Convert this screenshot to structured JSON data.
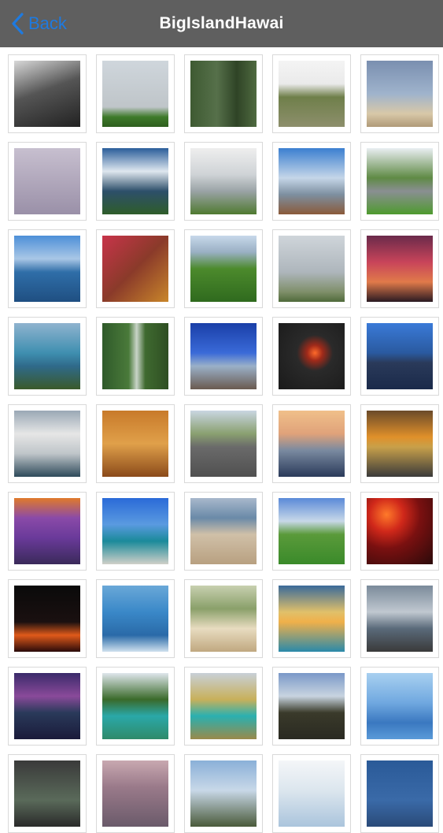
{
  "navbar": {
    "back_label": "Back",
    "title": "BigIslandHawai"
  },
  "gallery": {
    "thumbnails": [
      {
        "name": "thumb-lava-rock",
        "bg": "linear-gradient(160deg,#d8d8d8 0%,#555 45%,#222 100%)"
      },
      {
        "name": "thumb-wind-turbines",
        "bg": "linear-gradient(180deg,#cfd6dc 0%,#bfc5c9 70%,#3e7a2a 85%,#2e5e1e 100%)"
      },
      {
        "name": "thumb-green-cliffs",
        "bg": "linear-gradient(90deg,#3e5a32 0%,#56704a 40%,#2f4426 70%,#4f6a40 100%)"
      },
      {
        "name": "thumb-scrubland",
        "bg": "linear-gradient(180deg,#f4f4f4 0%,#eaeaea 35%,#6f7f4a 55%,#8d8f6c 100%)"
      },
      {
        "name": "thumb-driftwood-beach",
        "bg": "linear-gradient(180deg,#7a8fb0 0%,#9fb3cc 50%,#d8c8a8 80%,#b09a78 100%)"
      },
      {
        "name": "thumb-palm-silhouette",
        "bg": "linear-gradient(180deg,#c7bfcf 0%,#9a90a8 100%)"
      },
      {
        "name": "thumb-ocean-wave",
        "bg": "linear-gradient(180deg,#2a5d9a 0%,#dfe7ef 35%,#2d4f6a 65%,#2f5d2a 100%)"
      },
      {
        "name": "thumb-coastline-surf",
        "bg": "linear-gradient(180deg,#eeeeee 0%,#cfd3d6 40%,#9aa3a6 65%,#4f7a30 100%)"
      },
      {
        "name": "thumb-palm-mountain",
        "bg": "linear-gradient(180deg,#3b7fd0 0%,#c5d6e8 45%,#7d8fa0 70%,#8a5a3a 100%)"
      },
      {
        "name": "thumb-stone-bridge",
        "bg": "linear-gradient(180deg,#e9eef2 0%,#5f8a45 45%,#8a8f92 65%,#4e9a2e 100%)"
      },
      {
        "name": "thumb-calm-bay",
        "bg": "linear-gradient(180deg,#4d8fd8 0%,#a9c7e6 35%,#2f6ea8 55%,#1f4f82 100%)"
      },
      {
        "name": "thumb-red-coral-fish",
        "bg": "linear-gradient(135deg,#c8344a 0%,#8a3a2a 50%,#c9862a 100%)"
      },
      {
        "name": "thumb-green-fields",
        "bg": "linear-gradient(180deg,#c7d8ea 0%,#9ab0c4 25%,#4c8a2c 50%,#2f6a1e 100%)"
      },
      {
        "name": "thumb-white-church",
        "bg": "linear-gradient(180deg,#cfd5da 0%,#aeb6bc 55%,#7f8f6a 85%,#4f6a3a 100%)"
      },
      {
        "name": "thumb-red-sunset-palms",
        "bg": "linear-gradient(180deg,#6a2a4a 0%,#c8445a 40%,#e07a4a 70%,#2a1a22 100%)"
      },
      {
        "name": "thumb-coast-palm",
        "bg": "linear-gradient(180deg,#8fb3cf 0%,#3f8fb0 45%,#2f6a8a 65%,#3a5a2a 100%)"
      },
      {
        "name": "thumb-waterfall",
        "bg": "linear-gradient(90deg,#2f5a2a 0%,#4a7a3a 40%,#c8d4c8 52%,#3f6a30 65%,#2e4e22 100%)"
      },
      {
        "name": "thumb-blue-sky-shore",
        "bg": "linear-gradient(180deg,#1a3fa8 0%,#3a6ad8 45%,#9ab0c8 65%,#6a5a50 100%)"
      },
      {
        "name": "thumb-lava-glow-night",
        "bg": "radial-gradient(circle at 55% 45%,#ff6a2a 0%,#a02a1a 15%,#2a2a2a 35%,#1a1a1a 100%)"
      },
      {
        "name": "thumb-night-resort",
        "bg": "linear-gradient(180deg,#3a7ad8 0%,#2a5aa0 45%,#2a3a5a 60%,#1a2a4a 100%)"
      },
      {
        "name": "thumb-volcanic-plume",
        "bg": "linear-gradient(180deg,#9aa8b5 0%,#e6e6e6 35%,#bfc5c9 65%,#2e4a5a 100%)"
      },
      {
        "name": "thumb-tree-sunset",
        "bg": "linear-gradient(180deg,#c87a2a 0%,#e0a04a 50%,#8a4a1a 100%)"
      },
      {
        "name": "thumb-open-road",
        "bg": "linear-gradient(180deg,#c9d6e2 0%,#8aa070 35%,#6a6a6a 55%,#505050 100%)"
      },
      {
        "name": "thumb-sunset-ocean",
        "bg": "linear-gradient(180deg,#f0c08a 0%,#e0a27a 35%,#7a8aa0 60%,#2a3a5a 100%)"
      },
      {
        "name": "thumb-golden-horizon",
        "bg": "linear-gradient(180deg,#6a4a2a 0%,#e0902a 40%,#c8a04a 55%,#3a3a3a 100%)"
      },
      {
        "name": "thumb-purple-dusk",
        "bg": "linear-gradient(180deg,#e07a2a 0%,#8a4aa8 30%,#6a3a9a 60%,#3a2a5a 100%)"
      },
      {
        "name": "thumb-palm-bay",
        "bg": "linear-gradient(180deg,#2a6ad8 0%,#5a9ae0 40%,#1a8a9a 65%,#d0d0c8 100%)"
      },
      {
        "name": "thumb-sandy-beach",
        "bg": "linear-gradient(180deg,#a8b8cc 0%,#6a8aa8 30%,#d0c0a8 55%,#b8a080 100%)"
      },
      {
        "name": "thumb-golf-course",
        "bg": "linear-gradient(180deg,#5a8ad8 0%,#c8d8e8 35%,#5a9a3a 55%,#3a8a2a 100%)"
      },
      {
        "name": "thumb-erupting-volcano",
        "bg": "radial-gradient(circle at 30% 25%,#ff7a2a 0%,#d0281a 25%,#7a1010 50%,#2a0a0a 100%)"
      },
      {
        "name": "thumb-lava-flow",
        "bg": "linear-gradient(180deg,#0a0a0a 0%,#1a1010 55%,#e05a1a 75%,#2a0a0a 100%)"
      },
      {
        "name": "thumb-whale-tail",
        "bg": "linear-gradient(180deg,#6aa8d8 0%,#3a88c8 40%,#2a6aa8 75%,#cfe0ee 100%)"
      },
      {
        "name": "thumb-green-sand-beach",
        "bg": "linear-gradient(180deg,#c8d0b0 0%,#8aa06a 35%,#e8dcc0 65%,#c0a880 100%)"
      },
      {
        "name": "thumb-golden-clouds",
        "bg": "linear-gradient(180deg,#3a6a9a 0%,#e0c06a 40%,#f0b04a 55%,#2a8aaa 100%)"
      },
      {
        "name": "thumb-stormy-shore",
        "bg": "linear-gradient(180deg,#7a8a9a 0%,#c0c8d0 40%,#5a6a7a 65%,#3a3a3a 100%)"
      },
      {
        "name": "thumb-lava-ocean-night",
        "bg": "linear-gradient(180deg,#3a2a6a 0%,#8a4a9a 35%,#2a3a5a 60%,#1a1a3a 100%)"
      },
      {
        "name": "thumb-turquoise-cove",
        "bg": "linear-gradient(180deg,#dfe6ec 0%,#3a6a2a 40%,#2aa8a8 65%,#2f8a6a 100%)"
      },
      {
        "name": "thumb-green-crater-beach",
        "bg": "linear-gradient(180deg,#c8d0d8 0%,#c8b05a 40%,#2ab0b0 65%,#9a8a4a 100%)"
      },
      {
        "name": "thumb-mauna-kea",
        "bg": "linear-gradient(180deg,#7a98c8 0%,#c8d4e0 35%,#3a3a2a 60%,#2a2a22 100%)"
      },
      {
        "name": "thumb-dolphins",
        "bg": "linear-gradient(180deg,#a8d0f0 0%,#70a8e0 45%,#3a78c0 75%,#5a9ad8 100%)"
      },
      {
        "name": "thumb-dark-rocks",
        "bg": "linear-gradient(180deg,#3a3a3a 0%,#5a6a5a 60%,#2a2a2a 100%)"
      },
      {
        "name": "thumb-hills-horizon",
        "bg": "linear-gradient(180deg,#c8a8b0 0%,#9a7a8a 40%,#6a5a6a 100%)"
      },
      {
        "name": "thumb-sign-overlook",
        "bg": "linear-gradient(180deg,#8ab0d8 0%,#c8d8e8 45%,#4a5a3a 100%)"
      },
      {
        "name": "thumb-cloudy-sky",
        "bg": "linear-gradient(180deg,#f4f6f8 0%,#dce6ee 45%,#aac4dc 100%)"
      },
      {
        "name": "thumb-deep-blue",
        "bg": "linear-gradient(180deg,#2a5a98 0%,#3a6aa8 60%,#2a4a78 100%)"
      }
    ]
  }
}
